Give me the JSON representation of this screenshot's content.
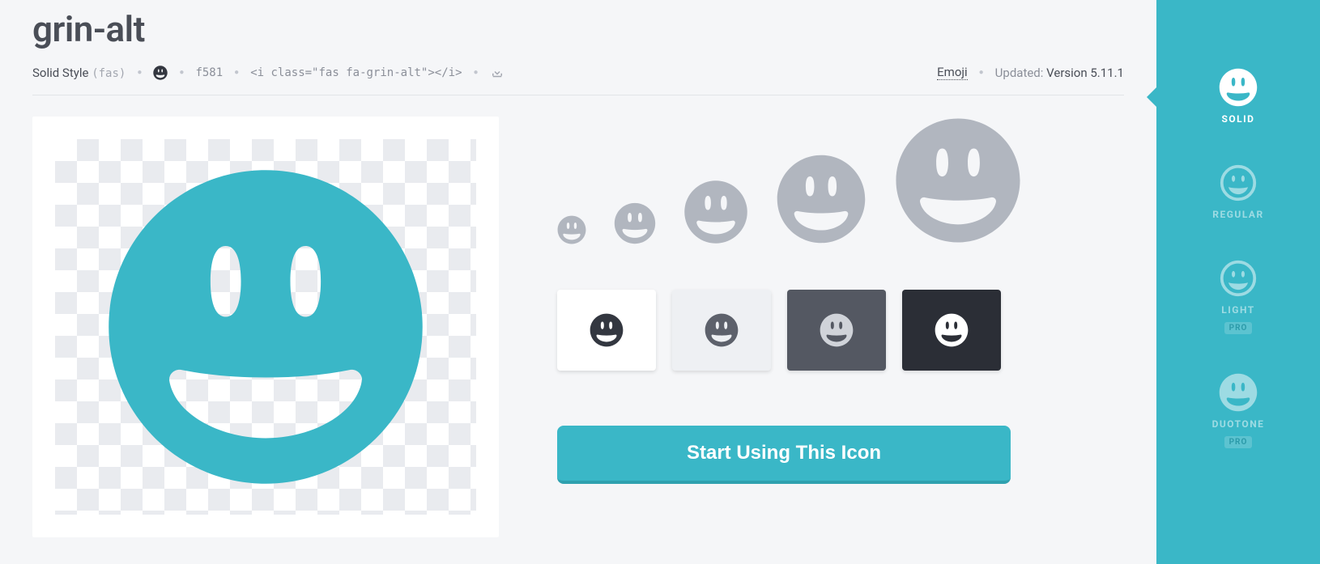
{
  "title": "grin-alt",
  "meta": {
    "style_label": "Solid Style",
    "style_prefix": "(fas)",
    "unicode": "f581",
    "snippet": "<i class=\"fas fa-grin-alt\"></i>",
    "category_link": "Emoji",
    "updated_label": "Updated:",
    "updated_version": "Version 5.11.1"
  },
  "cta": {
    "label": "Start Using This Icon"
  },
  "sidebar": {
    "items": [
      {
        "label": "SOLID",
        "pro": false,
        "active": true,
        "variant": "solid"
      },
      {
        "label": "REGULAR",
        "pro": false,
        "active": false,
        "variant": "regular"
      },
      {
        "label": "LIGHT",
        "pro": true,
        "active": false,
        "variant": "light"
      },
      {
        "label": "DUOTONE",
        "pro": true,
        "active": false,
        "variant": "duotone"
      }
    ],
    "pro_badge": "PRO"
  },
  "colors": {
    "brand": "#3ab7c7",
    "size_row": "#b1b6bf",
    "swatch_dark_icon": "#333740",
    "swatch_grey_icon": "#5d616b",
    "swatch_light_icon": "#d0d3d9"
  }
}
